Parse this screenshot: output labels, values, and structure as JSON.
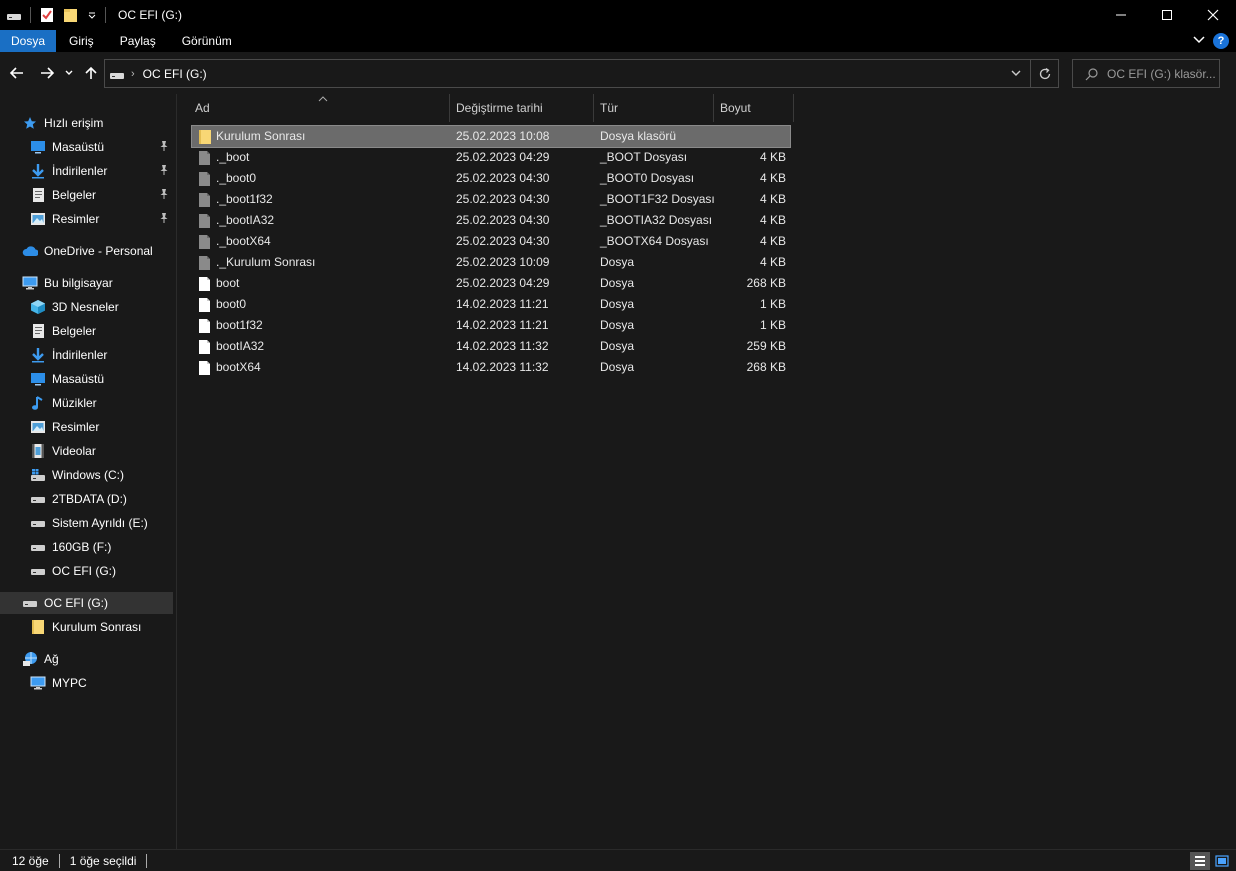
{
  "window": {
    "title": "OC EFI (G:)",
    "controls": [
      "minimize",
      "maximize",
      "close"
    ]
  },
  "ribbon": {
    "tabs": [
      {
        "label": "Dosya",
        "active": true
      },
      {
        "label": "Giriş"
      },
      {
        "label": "Paylaş"
      },
      {
        "label": "Görünüm"
      }
    ]
  },
  "address": {
    "path": "OC EFI (G:)",
    "search_placeholder": "OC EFI (G:) klasör..."
  },
  "sidebar": {
    "items": [
      {
        "label": "Hızlı erişim",
        "icon": "star-icon",
        "indent": 1
      },
      {
        "label": "Masaüstü",
        "icon": "desktop-icon",
        "indent": 2,
        "pinned": true
      },
      {
        "label": "İndirilenler",
        "icon": "download-icon",
        "indent": 2,
        "pinned": true
      },
      {
        "label": "Belgeler",
        "icon": "documents-icon",
        "indent": 2,
        "pinned": true
      },
      {
        "label": "Resimler",
        "icon": "pictures-icon",
        "indent": 2,
        "pinned": true
      },
      {
        "label": "OneDrive - Personal",
        "icon": "cloud-icon",
        "indent": 1
      },
      {
        "label": "Bu bilgisayar",
        "icon": "computer-icon",
        "indent": 1
      },
      {
        "label": "3D Nesneler",
        "icon": "cube-icon",
        "indent": 2
      },
      {
        "label": "Belgeler",
        "icon": "documents-icon",
        "indent": 2
      },
      {
        "label": "İndirilenler",
        "icon": "download-icon",
        "indent": 2
      },
      {
        "label": "Masaüstü",
        "icon": "desktop-icon",
        "indent": 2
      },
      {
        "label": "Müzikler",
        "icon": "music-icon",
        "indent": 2
      },
      {
        "label": "Resimler",
        "icon": "pictures-icon",
        "indent": 2
      },
      {
        "label": "Videolar",
        "icon": "video-icon",
        "indent": 2
      },
      {
        "label": "Windows (C:)",
        "icon": "windows-drive-icon",
        "indent": 2
      },
      {
        "label": "2TBDATA (D:)",
        "icon": "drive-icon",
        "indent": 2
      },
      {
        "label": "Sistem Ayrıldı (E:)",
        "icon": "drive-icon",
        "indent": 2
      },
      {
        "label": "160GB (F:)",
        "icon": "drive-icon",
        "indent": 2
      },
      {
        "label": "OC EFI (G:)",
        "icon": "drive-icon",
        "indent": 2
      },
      {
        "label": "OC EFI (G:)",
        "icon": "drive-icon",
        "indent": 1,
        "selected": true
      },
      {
        "label": "Kurulum Sonrası",
        "icon": "folder-icon",
        "indent": 2
      },
      {
        "label": "Ağ",
        "icon": "network-icon",
        "indent": 1
      },
      {
        "label": "MYPC",
        "icon": "computer-icon",
        "indent": 2
      }
    ]
  },
  "columns": {
    "name": "Ad",
    "date": "Değiştirme tarihi",
    "type": "Tür",
    "size": "Boyut"
  },
  "files": [
    {
      "name": "Kurulum Sonrası",
      "date": "25.02.2023 10:08",
      "type": "Dosya klasörü",
      "size": "",
      "icon": "folder-icon",
      "selected": true
    },
    {
      "name": "._boot",
      "date": "25.02.2023 04:29",
      "type": "_BOOT Dosyası",
      "size": "4 KB",
      "icon": "hidden-file-icon"
    },
    {
      "name": "._boot0",
      "date": "25.02.2023 04:30",
      "type": "_BOOT0 Dosyası",
      "size": "4 KB",
      "icon": "hidden-file-icon"
    },
    {
      "name": "._boot1f32",
      "date": "25.02.2023 04:30",
      "type": "_BOOT1F32 Dosyası",
      "size": "4 KB",
      "icon": "hidden-file-icon"
    },
    {
      "name": "._bootIA32",
      "date": "25.02.2023 04:30",
      "type": "_BOOTIA32 Dosyası",
      "size": "4 KB",
      "icon": "hidden-file-icon"
    },
    {
      "name": "._bootX64",
      "date": "25.02.2023 04:30",
      "type": "_BOOTX64 Dosyası",
      "size": "4 KB",
      "icon": "hidden-file-icon"
    },
    {
      "name": "._Kurulum Sonrası",
      "date": "25.02.2023 10:09",
      "type": "Dosya",
      "size": "4 KB",
      "icon": "hidden-file-icon"
    },
    {
      "name": "boot",
      "date": "25.02.2023 04:29",
      "type": "Dosya",
      "size": "268 KB",
      "icon": "file-icon"
    },
    {
      "name": "boot0",
      "date": "14.02.2023 11:21",
      "type": "Dosya",
      "size": "1 KB",
      "icon": "file-icon"
    },
    {
      "name": "boot1f32",
      "date": "14.02.2023 11:21",
      "type": "Dosya",
      "size": "1 KB",
      "icon": "file-icon"
    },
    {
      "name": "bootIA32",
      "date": "14.02.2023 11:32",
      "type": "Dosya",
      "size": "259 KB",
      "icon": "file-icon"
    },
    {
      "name": "bootX64",
      "date": "14.02.2023 11:32",
      "type": "Dosya",
      "size": "268 KB",
      "icon": "file-icon"
    }
  ],
  "status": {
    "item_count": "12 öğe",
    "selected_count": "1 öğe seçildi"
  },
  "colors": {
    "accent": "#1a6fc4",
    "folder": "#f8d775",
    "selected_row": "#6b6b6b"
  }
}
